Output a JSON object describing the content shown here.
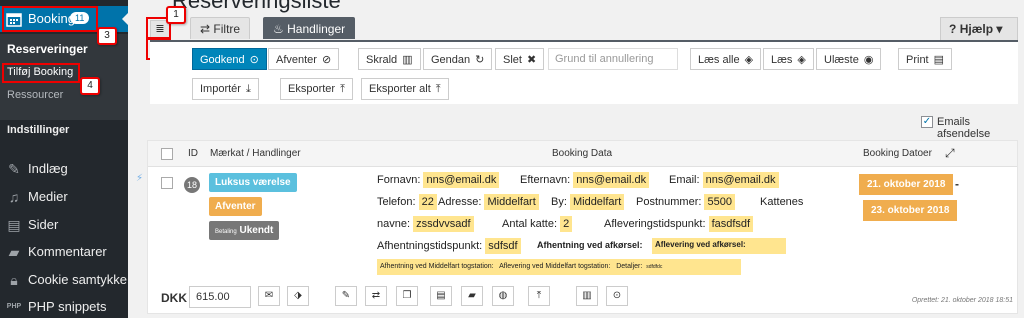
{
  "sidebar": {
    "booking_label": "Booking",
    "booking_badge": "11",
    "submenu": {
      "reservations": "Reserveringer",
      "add_booking": "Tilføj Booking",
      "resources": "Ressourcer"
    },
    "settings": "Indstillinger",
    "items": [
      {
        "label": "Indlæg",
        "icon": "pin-icon"
      },
      {
        "label": "Medier",
        "icon": "media-icon"
      },
      {
        "label": "Sider",
        "icon": "page-icon"
      },
      {
        "label": "Kommentarer",
        "icon": "comment-icon"
      },
      {
        "label": "Cookie samtykke",
        "icon": "lock-icon"
      },
      {
        "label": "PHP snippets",
        "icon": "php-icon"
      }
    ]
  },
  "header": {
    "title": "Reserveringsliste",
    "tabs": {
      "filter": "Filtre",
      "actions": "Handlinger"
    },
    "help": "Hjælp"
  },
  "toolbar": {
    "approve": "Godkend",
    "pending": "Afventer",
    "trash": "Skrald",
    "restore": "Gendan",
    "delete": "Slet",
    "reason_placeholder": "Grund til annullering",
    "read_all": "Læs alle",
    "read": "Læs",
    "unread": "Ulæste",
    "print": "Print",
    "import": "Importér",
    "export": "Eksporter",
    "export_all": "Eksporter alt"
  },
  "annotations": [
    "1",
    "2",
    "3",
    "4"
  ],
  "emails_label": "Emails afsendelse",
  "table": {
    "col_id": "ID",
    "col_labels": "Mærkat / Handlinger",
    "col_data": "Booking Data",
    "col_dates": "Booking Datoer",
    "row": {
      "id": "18",
      "resource_label": "Luksus værelse",
      "status_label": "Afventer",
      "payment_prefix": "Betaling",
      "payment_label": "Ukendt",
      "fields": {
        "fornavn_k": "Fornavn:",
        "fornavn_v": "nns@email.dk",
        "efternavn_k": "Efternavn:",
        "efternavn_v": "nns@email.dk",
        "email_k": "Email:",
        "email_v": "nns@email.dk",
        "telefon_k": "Telefon:",
        "telefon_v": "22",
        "adresse_k": "Adresse:",
        "adresse_v": "Middelfart",
        "by_k": "By:",
        "by_v": "Middelfart",
        "postnr_k": "Postnummer:",
        "postnr_v": "5500",
        "kattenes_k": "Kattenes",
        "navne_k": "navne:",
        "navne_v": "zssdvvsadf",
        "antal_k": "Antal katte:",
        "antal_v": "2",
        "afl_k": "Afleveringstidspunkt:",
        "afl_v": "fasdfsdf",
        "afh_k": "Afhentningstidspunkt:",
        "afh_v": "sdfsdf",
        "afh_mf_k": "Afhentning ved afkørsel:",
        "afl_mf_k": "Aflevering ved afkørsel:",
        "small1": "Afhentning ved Middelfart togstation:",
        "small2": "Aflevering ved Middelfart togstation:",
        "small3_k": "Detaljer:",
        "small3_v": "sdfdfdc"
      },
      "date_from": "21. oktober 2018",
      "date_sep": "-",
      "date_to": "23. oktober 2018",
      "currency": "DKK",
      "price": "615.00",
      "created": "Oprettet: 21. oktober 2018 18:51"
    }
  },
  "colors": {
    "sidebar": "#23282d",
    "accent": "#0073aa",
    "primary_btn": "#0085ba",
    "resource_label": "#5bc0de",
    "status_label": "#f0ad4e",
    "payment_label": "#777777",
    "date_badge": "#f0ad4e",
    "highlight": "#ffe58f",
    "annotation": "#ee0000"
  }
}
